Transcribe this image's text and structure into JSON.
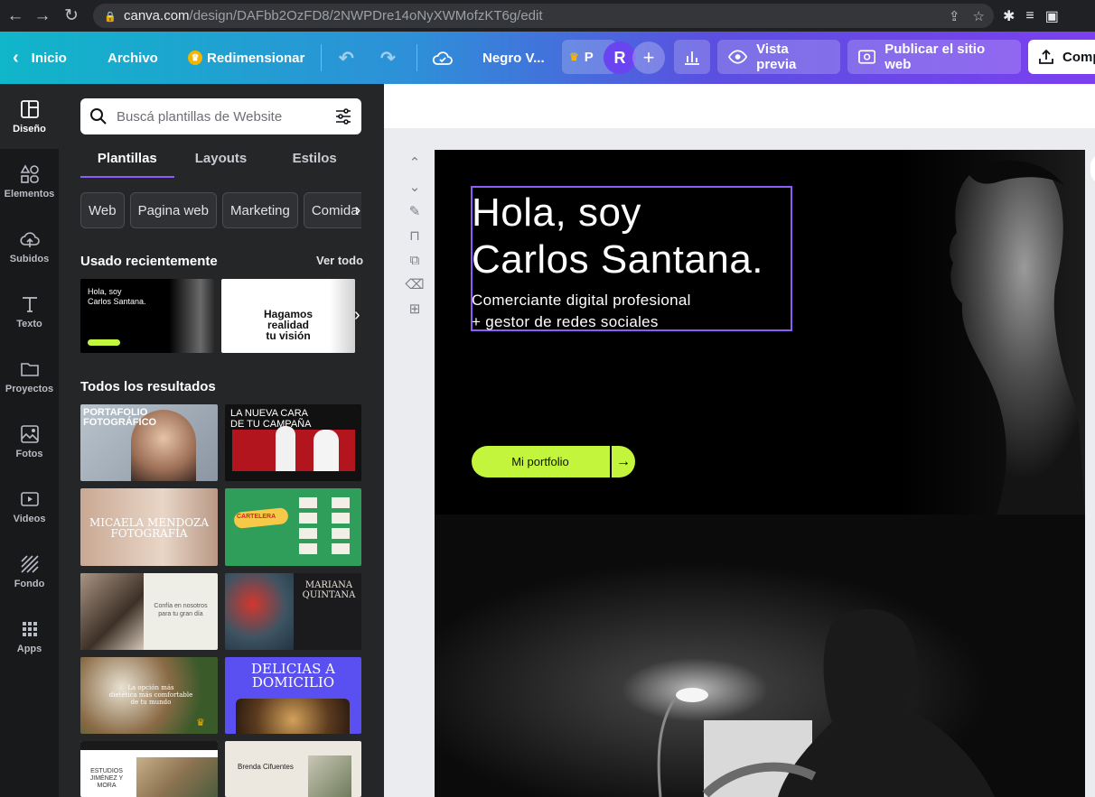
{
  "browser": {
    "url_host": "canva.com",
    "url_path": "/design/DAFbb2OzFD8/2NWPDre14oNyXWMofzKT6g/edit"
  },
  "topbar": {
    "home": "Inicio",
    "file": "Archivo",
    "resize": "Redimensionar",
    "doc_title": "Negro V...",
    "pro_short": "P",
    "avatar_initial": "R",
    "preview": "Vista previa",
    "publish": "Publicar el sitio web",
    "share": "Comp"
  },
  "rail": [
    {
      "label": "Diseño",
      "icon": "layout-icon"
    },
    {
      "label": "Elementos",
      "icon": "shapes-icon"
    },
    {
      "label": "Subidos",
      "icon": "cloud-upload-icon"
    },
    {
      "label": "Texto",
      "icon": "text-icon"
    },
    {
      "label": "Proyectos",
      "icon": "folder-icon"
    },
    {
      "label": "Fotos",
      "icon": "image-icon"
    },
    {
      "label": "Videos",
      "icon": "video-icon"
    },
    {
      "label": "Fondo",
      "icon": "pattern-icon"
    },
    {
      "label": "Apps",
      "icon": "grid-icon"
    }
  ],
  "panel": {
    "search_placeholder": "Buscá plantillas de Website",
    "tabs": [
      "Plantillas",
      "Layouts",
      "Estilos"
    ],
    "chips": [
      "Web",
      "Pagina web",
      "Marketing",
      "Comida"
    ],
    "recent_title": "Usado recientemente",
    "see_all": "Ver todo",
    "recent": [
      {
        "text": "Hola, soy\nCarlos Santana."
      },
      {
        "text": "Hagamos\nrealidad\ntu visión"
      }
    ],
    "all_title": "Todos los resultados",
    "results": [
      {
        "text": "PORTAFOLIO\nFOTOGRÁFICO"
      },
      {
        "text": "LA NUEVA CARA\nDE TU CAMPAÑA"
      },
      {
        "text": "MICAELA MENDOZA\nFOTOGRAFÍA"
      },
      {
        "text": "CARTELERA"
      },
      {
        "text": "Confía en nosotros\npara tu gran día"
      },
      {
        "text": "MARIANA\nQUINTANA"
      },
      {
        "text": "La opción más\ndietética más comfortable\nde tu mundo"
      },
      {
        "text": "DELICIAS A\nDOMICILIO"
      },
      {
        "text": "ESTUDIOS\nJIMÉNEZ Y\nMORA"
      },
      {
        "text": "Brenda Cifuentes"
      }
    ]
  },
  "hero": {
    "title": "Hola, soy\nCarlos Santana.",
    "subtitle": "Comerciante digital profesional\n+ gestor de redes sociales",
    "cta": "Mi portfolio"
  },
  "colors": {
    "accent": "#8b5cf6",
    "cta": "#c2f53b",
    "panel": "#252627",
    "rail": "#18191b"
  }
}
